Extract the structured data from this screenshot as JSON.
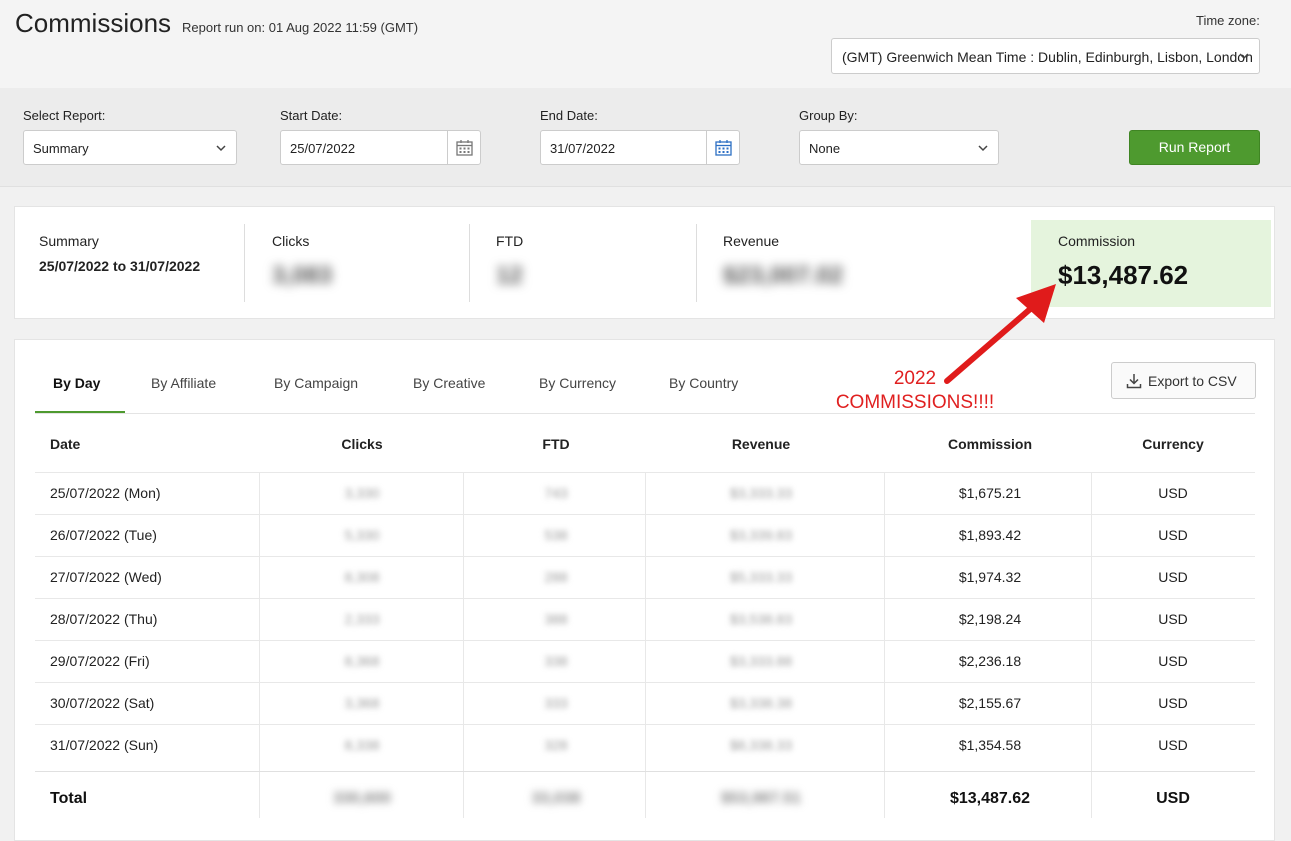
{
  "header": {
    "title": "Commissions",
    "run_info": "Report run on: 01 Aug 2022 11:59 (GMT)",
    "timezone_label": "Time zone:",
    "timezone_value": "(GMT) Greenwich Mean Time : Dublin, Edinburgh, Lisbon, London"
  },
  "filters": {
    "select_report_label": "Select Report:",
    "select_report_value": "Summary",
    "start_date_label": "Start Date:",
    "start_date_value": "25/07/2022",
    "end_date_label": "End Date:",
    "end_date_value": "31/07/2022",
    "group_by_label": "Group By:",
    "group_by_value": "None",
    "run_button": "Run Report"
  },
  "summary": {
    "title": "Summary",
    "range": "25/07/2022 to 31/07/2022",
    "clicks_label": "Clicks",
    "clicks_value": "3,083",
    "ftd_label": "FTD",
    "ftd_value": "12",
    "revenue_label": "Revenue",
    "revenue_value": "$23,007.02",
    "commission_label": "Commission",
    "commission_value": "$13,487.62"
  },
  "annotation": {
    "line1": "2022",
    "line2": "COMMISSIONS!!!!"
  },
  "tabs": [
    "By Day",
    "By Affiliate",
    "By Campaign",
    "By Creative",
    "By Currency",
    "By Country"
  ],
  "export_button": "Export to CSV",
  "table": {
    "headers": [
      "Date",
      "Clicks",
      "FTD",
      "Revenue",
      "Commission",
      "Currency"
    ],
    "rows": [
      [
        "25/07/2022 (Mon)",
        "3,330",
        "743",
        "$3,333.33",
        "$1,675.21",
        "USD"
      ],
      [
        "26/07/2022 (Tue)",
        "5,330",
        "538",
        "$3,339.83",
        "$1,893.42",
        "USD"
      ],
      [
        "27/07/2022 (Wed)",
        "8,308",
        "288",
        "$5,333.33",
        "$1,974.32",
        "USD"
      ],
      [
        "28/07/2022 (Thu)",
        "2,333",
        "388",
        "$3,538.83",
        "$2,198.24",
        "USD"
      ],
      [
        "29/07/2022 (Fri)",
        "8,368",
        "338",
        "$3,333.88",
        "$2,236.18",
        "USD"
      ],
      [
        "30/07/2022 (Sat)",
        "3,368",
        "333",
        "$3,338.38",
        "$2,155.67",
        "USD"
      ],
      [
        "31/07/2022 (Sun)",
        "8,338",
        "328",
        "$8,338.33",
        "$1,354.58",
        "USD"
      ]
    ],
    "total": [
      "Total",
      "330,600",
      "33,038",
      "$53,987.51",
      "$13,487.62",
      "USD"
    ]
  }
}
